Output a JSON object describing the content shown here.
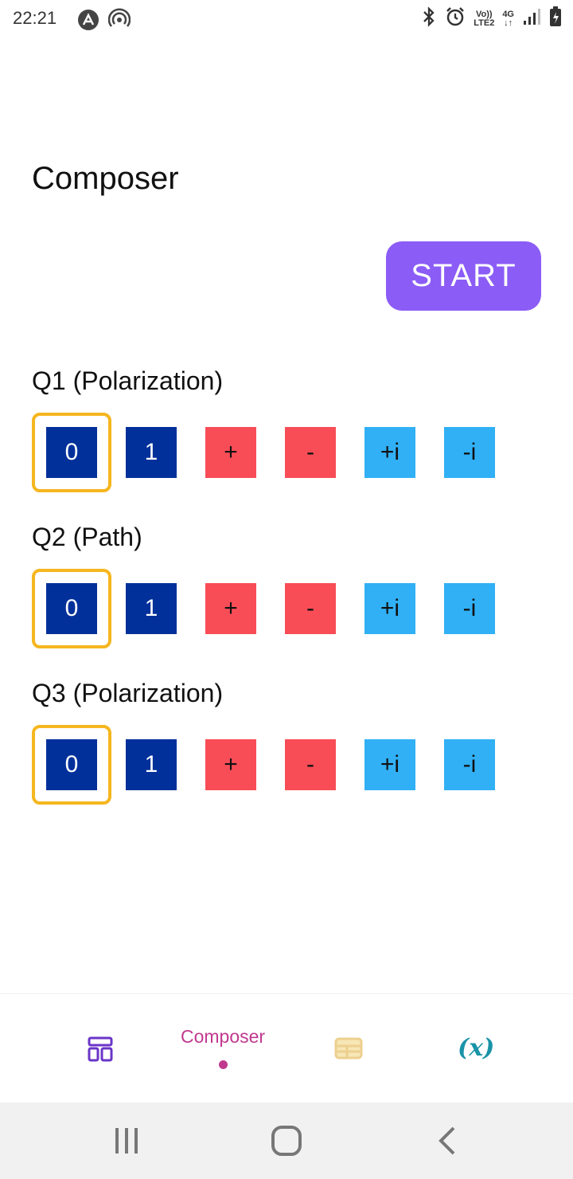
{
  "status_bar": {
    "time": "22:21",
    "volte_top": "Vo))",
    "volte_bottom": "LTE2",
    "network": "4G"
  },
  "screen": {
    "title": "Composer",
    "start_label": "START"
  },
  "qubits": [
    {
      "label": "Q1 (Polarization)",
      "selected": "0"
    },
    {
      "label": "Q2 (Path)",
      "selected": "0"
    },
    {
      "label": "Q3 (Polarization)",
      "selected": "0"
    }
  ],
  "options": [
    "0",
    "1",
    "+",
    "-",
    "+i",
    "-i"
  ],
  "colors": {
    "accent": "#8b5cf6",
    "selected_frame": "#f5b61f",
    "basis_z": "#02309a",
    "basis_x": "#f84d57",
    "basis_y": "#31b0f5",
    "nav_active": "#c0398f"
  },
  "bottom_nav": {
    "items": [
      {
        "icon": "layout-dashboard-icon",
        "label": ""
      },
      {
        "icon": "composer-tab",
        "label": "Composer"
      },
      {
        "icon": "table-icon",
        "label": ""
      },
      {
        "icon": "variable-x-icon",
        "label": "(x)"
      }
    ]
  },
  "system_nav": {
    "items": [
      "recent-apps-icon",
      "home-icon",
      "back-icon"
    ]
  }
}
